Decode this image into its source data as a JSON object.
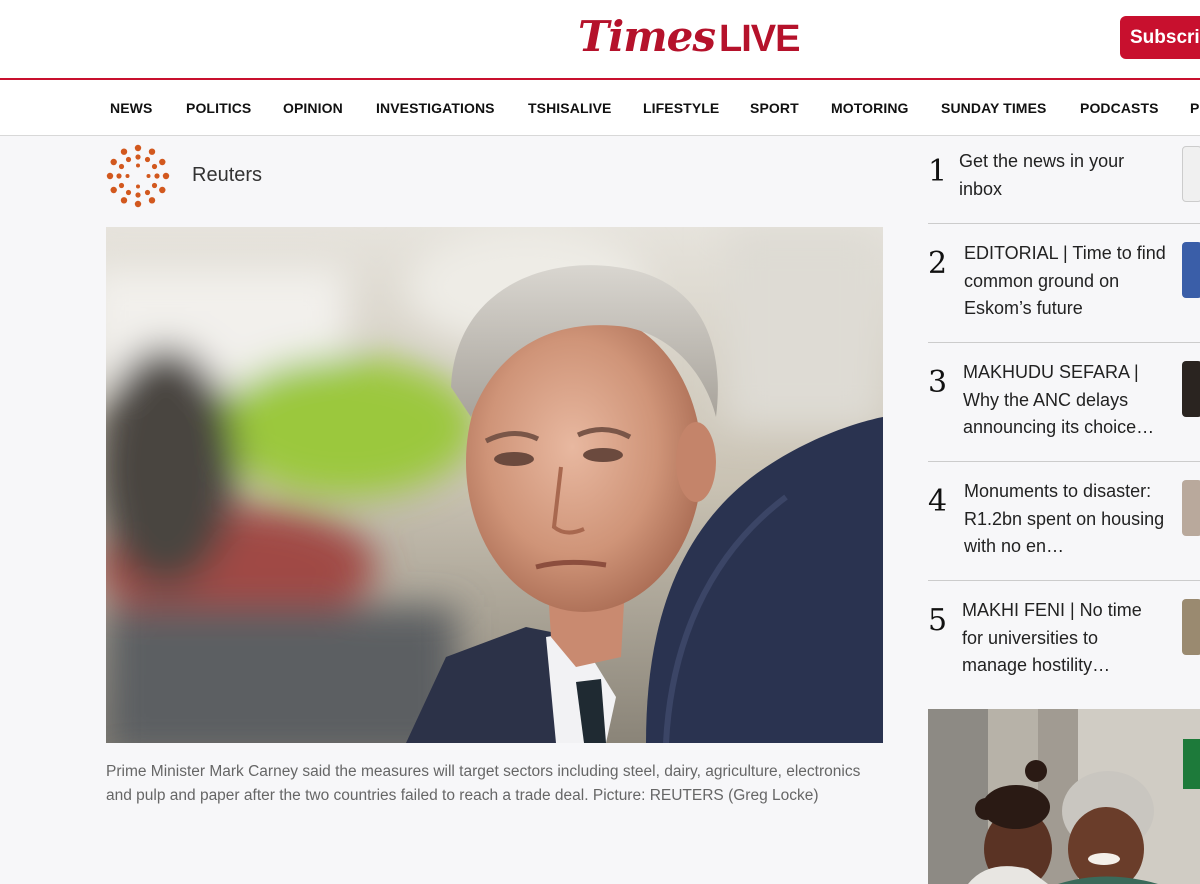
{
  "header": {
    "logo_times": "Times",
    "logo_live": "LIVE",
    "subscribe_label": "Subscribe"
  },
  "nav": {
    "items": [
      "NEWS",
      "POLITICS",
      "OPINION",
      "INVESTIGATIONS",
      "TSHISALIVE",
      "LIFESTYLE",
      "SPORT",
      "MOTORING",
      "SUNDAY TIMES",
      "PODCASTS",
      "P"
    ]
  },
  "article": {
    "author": "Reuters",
    "caption": "Prime Minister Mark Carney said the measures will target sectors including steel, dairy, agriculture, electronics and pulp and paper after the two countries failed to reach a trade deal. Picture: REUTERS (Greg Locke)"
  },
  "trending": [
    {
      "num": "1",
      "title": "Get the news in your inbox"
    },
    {
      "num": "2",
      "title": "EDITORIAL | Time to find common ground on Eskom’s future"
    },
    {
      "num": "3",
      "title": "MAKHUDU SEFARA | Why the ANC delays announcing its choice…"
    },
    {
      "num": "4",
      "title": "Monuments to disaster: R1.2bn spent on housing with no en…"
    },
    {
      "num": "5",
      "title": "MAKHI FENI | No time for universities to manage hostility…"
    }
  ],
  "colors": {
    "brand": "#c8102e",
    "reuters_orange": "#d2581e"
  }
}
